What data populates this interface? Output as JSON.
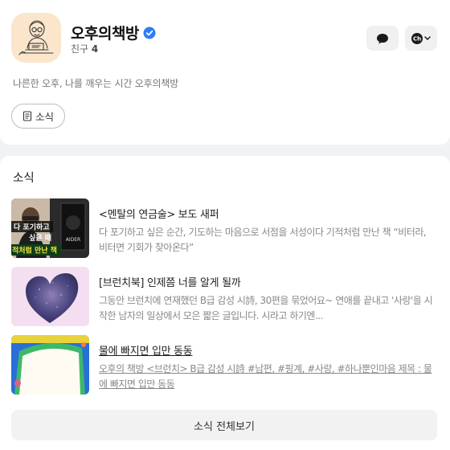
{
  "profile": {
    "name": "오후의책방",
    "friends_label": "친구",
    "friends_count": "4",
    "description": "나른한 오후, 나를 깨우는 시간 오후의책방",
    "news_chip_label": "소식",
    "ch_button_label": "Ch"
  },
  "news": {
    "section_title": "소식",
    "items": [
      {
        "title": "<멘탈의 연금술> 보도 새퍼",
        "body": "다 포기하고 싶은 순간, 기도하는 마음으로 서점을 서성이다 기적처럼 만난 책 “비터라, 비터면 기회가 찾아온다”",
        "thumb_text_1": "다 포기하고",
        "thumb_text_2": "싶을 때",
        "thumb_text_3": "적처럼 만난 책",
        "thumb_book_text": "AIDER"
      },
      {
        "title": "[브런치북] 인제쯤 너를 알게 될까",
        "body": "그동안 브런치에 연재했던 B급 감성 시詩, 30편을 묶었어요~ 연애를 끝내고 '사랑'을 시작한 남자의 일상에서 모은 짧은 글입니다. 시라고 하기엔..."
      },
      {
        "title": "물에 빠지면 입만 동동",
        "body": "오후의 책방 <브런치> B급 감성 시詩 #남편, #핑계, #사랑, #하나뿐인마음 제목 : 물에 빠지면 입만 동동"
      }
    ],
    "all_button_label": "소식 전체보기"
  },
  "colors": {
    "verified": "#2e7cf6",
    "card_bg": "#ffffff",
    "page_bg": "#f1f2f4"
  }
}
